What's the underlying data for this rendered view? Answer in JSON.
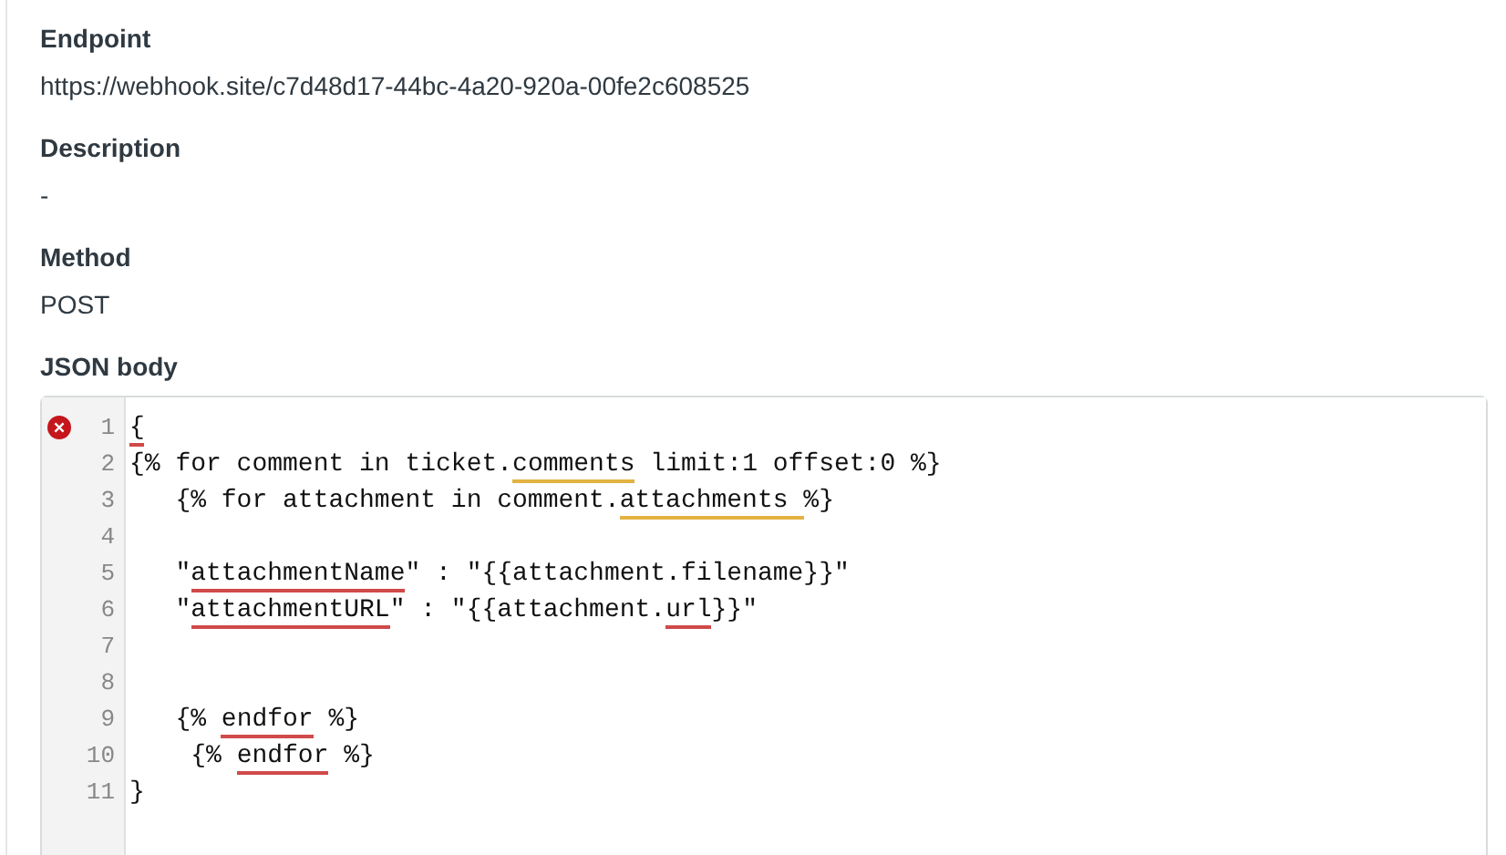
{
  "fields": [
    {
      "label": "Endpoint",
      "value": "https://webhook.site/c7d48d17-44bc-4a20-920a-00fe2c608525"
    },
    {
      "label": "Description",
      "value": "-"
    },
    {
      "label": "Method",
      "value": "POST"
    }
  ],
  "json_body": {
    "label": "JSON body",
    "lines": [
      {
        "number": "1",
        "error": true,
        "segments": [
          {
            "text": "{",
            "kind": "error"
          }
        ]
      },
      {
        "number": "2",
        "error": false,
        "segments": [
          {
            "text": "{% for comment in ticket.",
            "kind": "plain"
          },
          {
            "text": "comments",
            "kind": "warning"
          },
          {
            "text": " limit:1 offset:0 %}",
            "kind": "plain"
          }
        ]
      },
      {
        "number": "3",
        "error": false,
        "segments": [
          {
            "text": "   {% for attachment in comment.",
            "kind": "plain"
          },
          {
            "text": "attachments ",
            "kind": "warning"
          },
          {
            "text": "%}",
            "kind": "plain"
          }
        ]
      },
      {
        "number": "4",
        "error": false
      },
      {
        "number": "5",
        "error": false,
        "segments": [
          {
            "text": "   \"",
            "kind": "plain"
          },
          {
            "text": "attachmentName",
            "kind": "error"
          },
          {
            "text": "\" : \"{{attachment.filename}}\"",
            "kind": "plain"
          }
        ]
      },
      {
        "number": "6",
        "error": false,
        "segments": [
          {
            "text": "   \"",
            "kind": "plain"
          },
          {
            "text": "attachmentURL",
            "kind": "error"
          },
          {
            "text": "\" : \"{{attachment.",
            "kind": "plain"
          },
          {
            "text": "url",
            "kind": "error"
          },
          {
            "text": "}}\"",
            "kind": "plain"
          }
        ]
      },
      {
        "number": "7",
        "error": false
      },
      {
        "number": "8",
        "error": false
      },
      {
        "number": "9",
        "error": false,
        "segments": [
          {
            "text": "   {% ",
            "kind": "plain"
          },
          {
            "text": "endfor",
            "kind": "error"
          },
          {
            "text": " %}",
            "kind": "plain"
          }
        ]
      },
      {
        "number": "10",
        "error": false,
        "segments": [
          {
            "text": "    {% ",
            "kind": "plain"
          },
          {
            "text": "endfor",
            "kind": "error"
          },
          {
            "text": " %}",
            "kind": "plain"
          }
        ]
      },
      {
        "number": "11",
        "error": false,
        "segments": [
          {
            "text": "}",
            "kind": "plain"
          }
        ]
      }
    ]
  }
}
